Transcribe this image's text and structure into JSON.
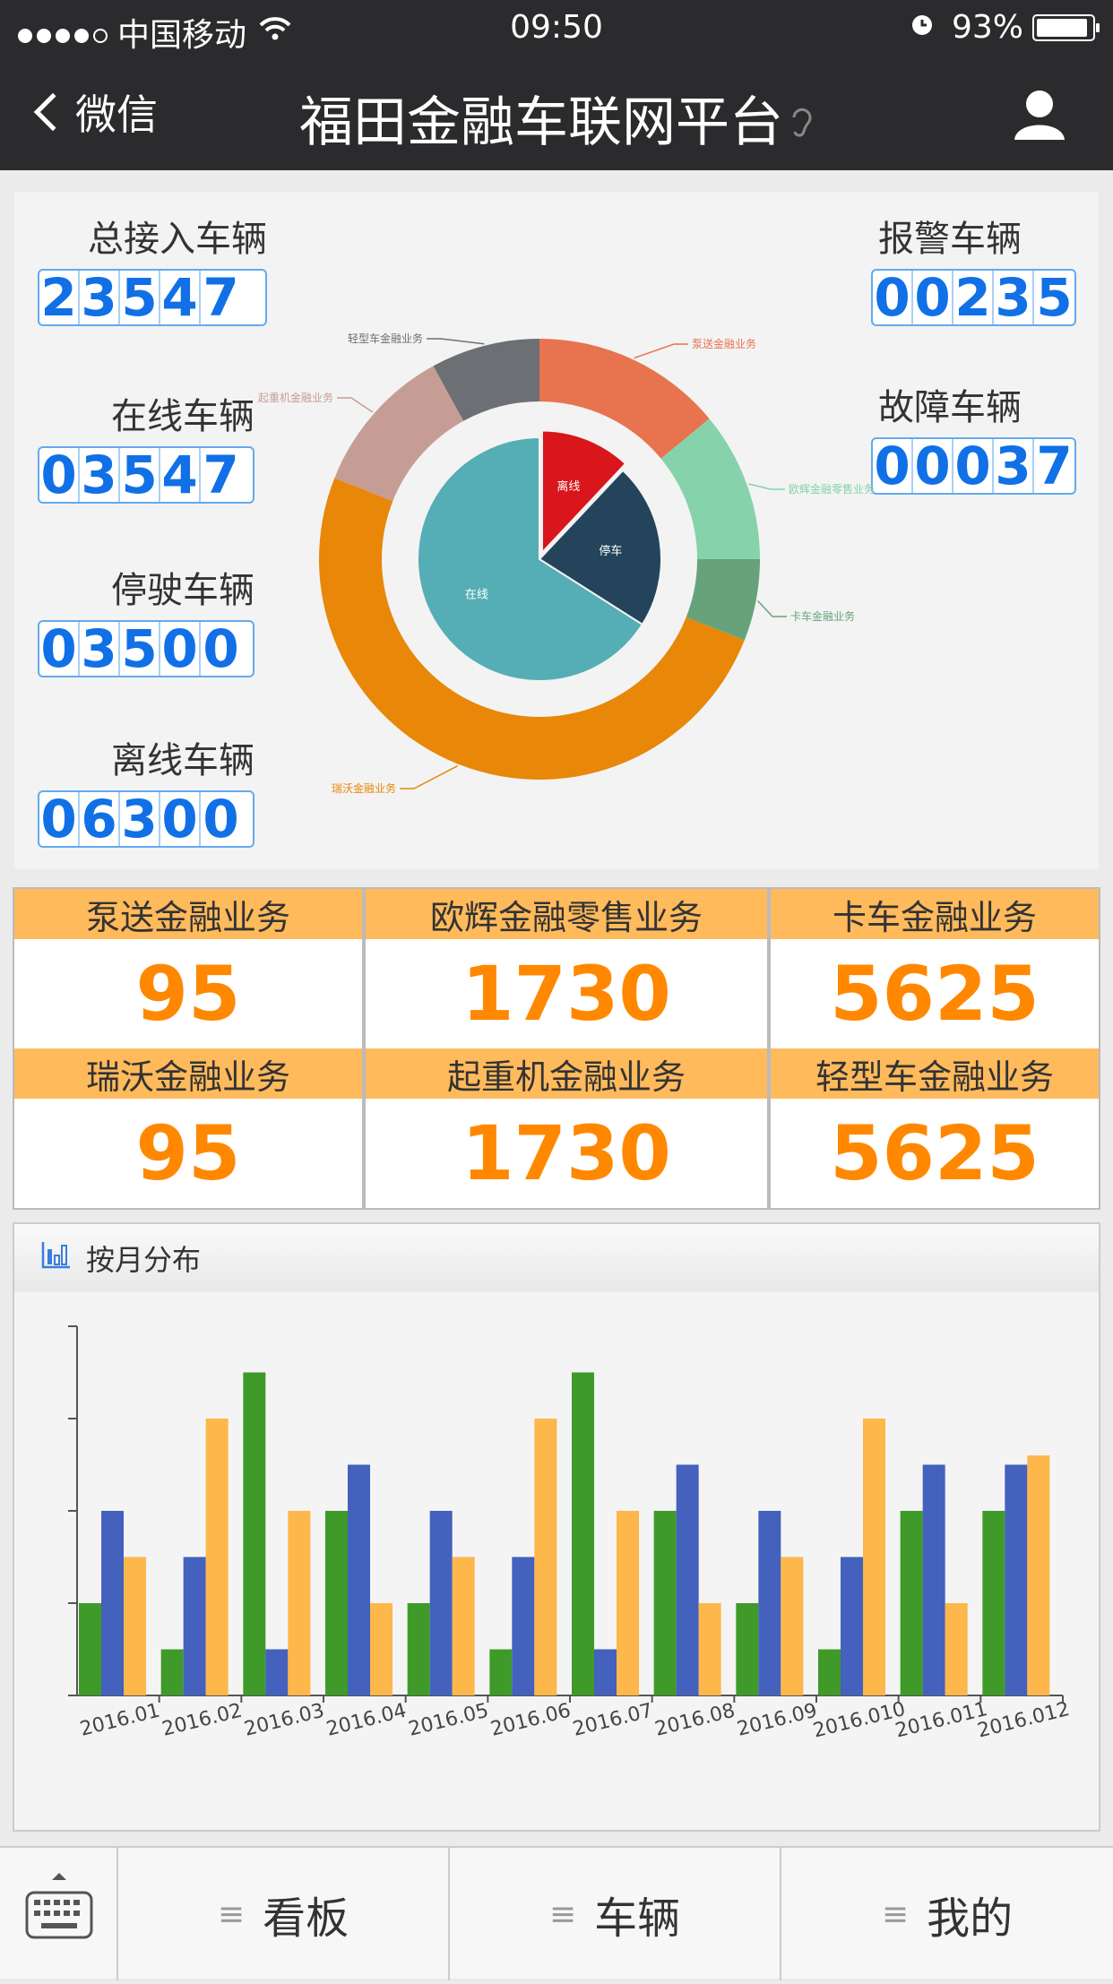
{
  "status_bar": {
    "carrier": "中国移动",
    "time": "09:50",
    "battery": "93%",
    "battery_level": 0.93
  },
  "nav": {
    "back_label": "微信",
    "title": "福田金融车联网平台"
  },
  "stats": [
    {
      "label": "总接入车辆",
      "value": "23547"
    },
    {
      "label": "在线车辆",
      "value": "03547"
    },
    {
      "label": "停驶车辆",
      "value": "03500"
    },
    {
      "label": "离线车辆",
      "value": "06300"
    },
    {
      "label": "报警车辆",
      "value": "00235"
    },
    {
      "label": "故障车辆",
      "value": "00037"
    }
  ],
  "donut": {
    "inner": [
      {
        "name": "离线",
        "value": 12,
        "color": "#d9161c"
      },
      {
        "name": "停车",
        "value": 22,
        "color": "#24445c"
      },
      {
        "name": "在线",
        "value": 66,
        "color": "#55aeb5"
      }
    ],
    "outer": [
      {
        "name": "泵送金融业务",
        "value": 14,
        "color": "#e8734f"
      },
      {
        "name": "欧辉金融零售业务",
        "value": 11,
        "color": "#86d2ab"
      },
      {
        "name": "卡车金融业务",
        "value": 6,
        "color": "#67a37a"
      },
      {
        "name": "瑞沃金融业务",
        "value": 50,
        "color": "#e88708"
      },
      {
        "name": "起重机金融业务",
        "value": 11,
        "color": "#c69d94"
      },
      {
        "name": "轻型车金融业务",
        "value": 8,
        "color": "#6c6f74"
      }
    ]
  },
  "business": [
    {
      "label": "泵送金融业务",
      "value": "95"
    },
    {
      "label": "欧辉金融零售业务",
      "value": "1730"
    },
    {
      "label": "卡车金融业务",
      "value": "5625"
    },
    {
      "label": "瑞沃金融业务",
      "value": "95"
    },
    {
      "label": "起重机金融业务",
      "value": "1730"
    },
    {
      "label": "轻型车金融业务",
      "value": "5625"
    }
  ],
  "chart_panel": {
    "title": "按月分布"
  },
  "chart_data": {
    "type": "bar",
    "categories": [
      "2016.01",
      "2016.02",
      "2016.03",
      "2016.04",
      "2016.05",
      "2016.06",
      "2016.07",
      "2016.08",
      "2016.09",
      "2016.010",
      "2016.011",
      "2016.012"
    ],
    "ylim": [
      0,
      4
    ],
    "grid": false,
    "series": [
      {
        "color": "#3f9a2a",
        "values": [
          1,
          0.5,
          3.5,
          2,
          1,
          0.5,
          3.5,
          2,
          1,
          0.5,
          2,
          2
        ]
      },
      {
        "color": "#4361bd",
        "values": [
          2,
          1.5,
          0.5,
          2.5,
          2,
          1.5,
          0.5,
          2.5,
          2,
          1.5,
          2.5,
          2.5
        ]
      },
      {
        "color": "#fdb74a",
        "values": [
          1.5,
          3,
          2,
          1,
          1.5,
          3,
          2,
          1,
          1.5,
          3,
          1,
          2.6
        ]
      }
    ]
  },
  "tabbar": {
    "tabs": [
      "看板",
      "车辆",
      "我的"
    ]
  }
}
